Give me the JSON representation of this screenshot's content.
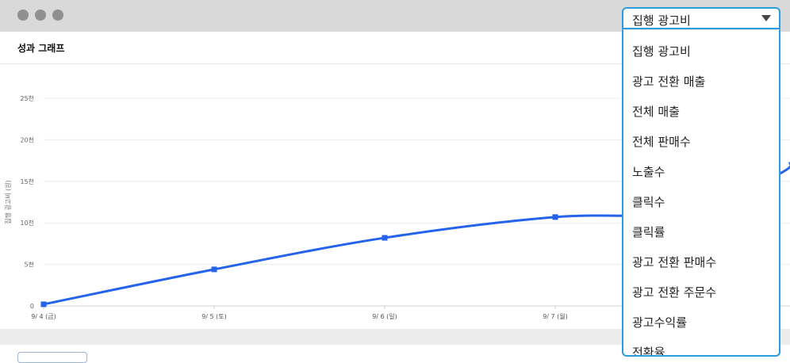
{
  "window": {
    "dot_color": "#8f8f8f",
    "bar_color": "#d9d9d9"
  },
  "panel": {
    "title": "성과 그래프"
  },
  "dropdown": {
    "selected": "집행 광고비",
    "options": [
      "집행 광고비",
      "광고 전환 매출",
      "전체 매출",
      "전체 판매수",
      "노출수",
      "클릭수",
      "클릭률",
      "광고 전환 판매수",
      "광고 전환 주문수",
      "광고수익률",
      "전환율"
    ],
    "border_color": "#2b9be0"
  },
  "chart_data": {
    "type": "line",
    "ylabel": "집행 광고비 (원)",
    "y_ticks": [
      "0",
      "5천",
      "10천",
      "15천",
      "20천",
      "25천"
    ],
    "ylim": [
      0,
      25000
    ],
    "categories": [
      "9/ 4 (금)",
      "9/ 5 (토)",
      "9/ 6 (일)",
      "9/ 7 (월)"
    ],
    "series": [
      {
        "values": [
          200,
          4400,
          8200,
          10700
        ],
        "color": "#2563eb"
      }
    ],
    "grid": true
  }
}
